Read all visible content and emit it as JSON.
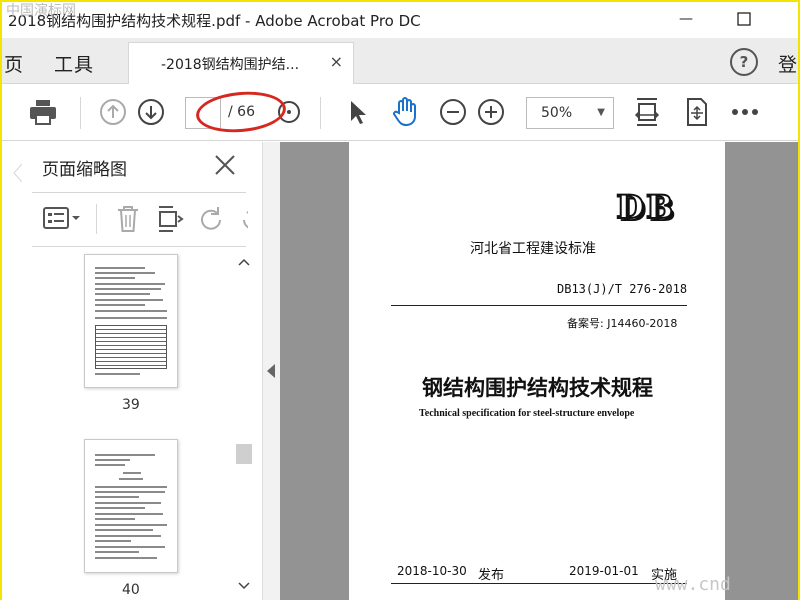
{
  "window": {
    "title": "2018钢结构围护结构技术规程.pdf - Adobe Acrobat Pro DC",
    "minimize_glyph": "—",
    "maximize_glyph": "☐"
  },
  "tabs": {
    "home_partial": "页",
    "tools": "工具",
    "document": "-2018钢结构围护结...",
    "close_glyph": "×",
    "help": "?",
    "login_partial": "登"
  },
  "toolbar": {
    "page_input": "",
    "page_total": "/ 66",
    "zoom": "50%"
  },
  "sidebar": {
    "title": "页面缩略图",
    "thumbnails": [
      {
        "page": "39"
      },
      {
        "page": "40"
      }
    ]
  },
  "document": {
    "logo": "DB",
    "org": "河北省工程建设标准",
    "code": "DB13(J)/T 276-2018",
    "record": "备案号: J14460-2018",
    "title": "钢结构围护结构技术规程",
    "subtitle_en": "Technical specification for steel-structure envelope",
    "issue_date": "2018-10-30",
    "issue_label": "发布",
    "effect_date": "2019-01-01",
    "effect_label": "实施"
  },
  "watermarks": {
    "top_left": "中国演标网",
    "bottom_right": "www.cnd"
  },
  "colors": {
    "accent_blue": "#1a73c8",
    "annotation_red": "#d7281f",
    "border_yellow": "#f2e600"
  }
}
